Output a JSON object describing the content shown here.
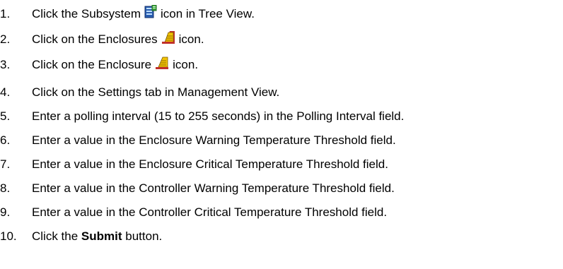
{
  "steps": [
    {
      "number": "1.",
      "before": "Click the Subsystem",
      "icon": "subsystem-icon",
      "after": "icon in Tree View."
    },
    {
      "number": "2.",
      "before": "Click on the Enclosures",
      "icon": "enclosures-icon",
      "after": "icon."
    },
    {
      "number": "3.",
      "before": "Click on the Enclosure",
      "icon": "enclosure-icon",
      "after": "icon."
    },
    {
      "number": "4.",
      "text": "Click on the Settings tab in Management View."
    },
    {
      "number": "5.",
      "text": "Enter a polling interval (15 to 255 seconds) in the Polling Interval field."
    },
    {
      "number": "6.",
      "text": "Enter a value in the Enclosure Warning Temperature Threshold field."
    },
    {
      "number": "7.",
      "text": "Enter a value in the Enclosure Critical Temperature Threshold field."
    },
    {
      "number": "8.",
      "text": "Enter a value in the Controller Warning Temperature Threshold field."
    },
    {
      "number": "9.",
      "text": "Enter a value in the Controller Critical Temperature Threshold field."
    },
    {
      "number": "10.",
      "before": "Click the",
      "bold": "Submit",
      "after": "button."
    }
  ],
  "colors": {
    "text": "#000000",
    "subsystem_icon_blue": "#2a5db0",
    "subsystem_icon_green": "#3aa33a",
    "enclosure_icon_yellow": "#f2c200",
    "enclosure_icon_red": "#c0302a"
  }
}
